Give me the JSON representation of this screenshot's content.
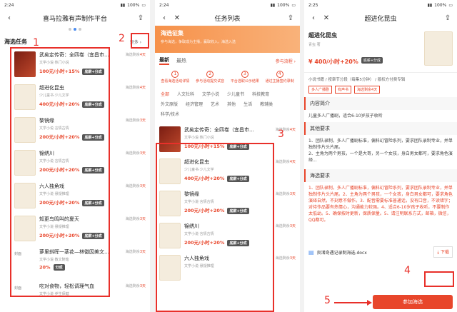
{
  "status": {
    "time": "2:24",
    "battery": "100%"
  },
  "status3": {
    "time": "2:25",
    "battery": "100%"
  },
  "p1": {
    "title": "喜马拉雅有声制作平台",
    "section": "海选任务",
    "more": "更多 ›",
    "items": [
      {
        "title": "武矣定传奇：全四卷（宜昌市...",
        "sub": "文学小说·热门小说",
        "price": "100元/小时+15%",
        "tag": "底薪+分成",
        "remain_label": "海选剩余",
        "remain": "4天",
        "cover": "red"
      },
      {
        "title": "超进化昆虫",
        "sub": "少儿童书·少儿文学",
        "price": "400元/小时+20%",
        "tag": "底薪+分成",
        "remain_label": "海选剩余",
        "remain": "4天",
        "cover": "light"
      },
      {
        "title": "黎镜缘",
        "sub": "文学小说·言情古情",
        "price": "200元/小时+20%",
        "tag": "底薪+分成",
        "remain_label": "海选剩余",
        "remain": "3天",
        "cover": "light"
      },
      {
        "title": "锦绣川",
        "sub": "文学小说·言情古情",
        "price": "200元/小时+20%",
        "tag": "底薪+分成",
        "remain_label": "海选剩余",
        "remain": "3天",
        "cover": "light"
      },
      {
        "title": "六人独角戏",
        "sub": "文学小说·悬疑推理",
        "price": "200元/小时+20%",
        "tag": "底薪+分成",
        "remain_label": "海选剩余",
        "remain": "3天",
        "cover": "light"
      },
      {
        "title": "知更鸟鸣叫的夏天",
        "sub": "文学小说·悬疑推理",
        "price": "200元/小时+20%",
        "tag": "底薪+分成",
        "remain_label": "海选剩余",
        "remain": "3天",
        "cover": "light"
      },
      {
        "title": "萝里斜晖一茎花—林徽因美文-...",
        "sub": "文学小说·散文随笔",
        "price": "20%",
        "tag": "分成",
        "remain_label": "海选剩余",
        "remain": "3天",
        "cover": "none"
      }
    ],
    "cover_alt": "封面",
    "last": {
      "title": "吃对食物，轻松调理气血",
      "sub": "文学小说·养生保健",
      "remain_label": "海选剩余",
      "remain": "3天"
    }
  },
  "p2": {
    "title": "任务列表",
    "banner_title": "海选征集",
    "banner_sub": "参与海选，争取成为主播，赢取收入，海选入选",
    "tabs": [
      "最新",
      "最热"
    ],
    "flow": "参与流程 ›",
    "steps": [
      {
        "num": "1",
        "label": "查看海选活动详情"
      },
      {
        "num": "2",
        "label": "参与活动提交试音"
      },
      {
        "num": "3",
        "label": "平台选取公示结果"
      },
      {
        "num": "4",
        "label": "通过主播签约录制"
      }
    ],
    "filters": [
      "全部",
      "人文社科",
      "文学小说",
      "少儿童书",
      "科技教育",
      "外文原版",
      "经济管理",
      "艺术",
      "其他",
      "生活",
      "教辅类",
      "科学/技术"
    ],
    "items": [
      {
        "title": "武矣定传奇：全四卷（宜昌市...",
        "sub": "文学小说·热门小说",
        "price": "100元/小时+15%",
        "tag": "底薪+分成",
        "remain_label": "海选剩余",
        "remain": "4天",
        "cover": "red"
      },
      {
        "title": "超进化昆虫",
        "sub": "少儿童书·少儿文学",
        "price": "400元/小时+20%",
        "tag": "底薪+分成",
        "remain_label": "海选剩余",
        "remain": "4天",
        "cover": "light"
      },
      {
        "title": "黎镜缘",
        "sub": "文学小说·言情古情",
        "price": "200元/小时+20%",
        "tag": "底薪+分成",
        "remain_label": "海选剩余",
        "remain": "3天",
        "cover": "light"
      },
      {
        "title": "锦绣川",
        "sub": "文学小说·言情古情",
        "price": "200元/小时+20%",
        "tag": "底薪+分成",
        "remain_label": "海选剩余",
        "remain": "3天",
        "cover": "light"
      },
      {
        "title": "六人独角戏",
        "sub": "文学小说·悬疑推理",
        "price": "",
        "tag": "",
        "remain_label": "海选剩余",
        "remain": "3天",
        "cover": "light"
      }
    ]
  },
  "p3": {
    "title": "超进化昆虫",
    "book_title": "超进化昆虫",
    "author": "青虫 著",
    "price": "¥ 400/小时+20%",
    "tag": "底薪+分成",
    "meta1": "小说书籍 / 按章节分段（每集5分钟） / 版权方付费专辑",
    "meta2_a": "多人广播剧",
    "meta2_b": "有声书",
    "meta2_c": "海选剩余4天",
    "intro_title": "内容简介",
    "intro": "儿童多人广播剧，适合6-10岁孩子收听",
    "other_title": "其他要求",
    "other": "1、团队录制，多人广播剧标准，偏科幻冒险系列，要求团队录制专业，并单独制作片头片尾。\n2、主角为两个男孩，一个是大哥，另一个女孩，身白男女都可，要求角色演绎...",
    "req_title": "海选要求",
    "req": "1、团队录制，多人广播剧标准，偏科幻冒险系列，要求团队录制专业，并单独制作片头片尾。2、主角为两个男孩，一个女孩，身白男女都可，要求角色演绎自然，不刻意不做作。3、配音需要标准普通话，没有口音，不读错字；对待作品要有热情心，沟通能力较强。4、适合6-10岁孩子收听，不要制作太低幼。5、确保按时更新，保质保量。5、请注明联系方式，邮箱，微信，QQ都可。",
    "file": "良渚奇遇记录制海选.docx",
    "download": "下载",
    "join": "参加海选"
  },
  "annotations": [
    "1",
    "2",
    "3",
    "4",
    "5"
  ],
  "colors": {
    "accent": "#e8462b",
    "highlight": "#e8302a",
    "banner": "#f6914a"
  }
}
